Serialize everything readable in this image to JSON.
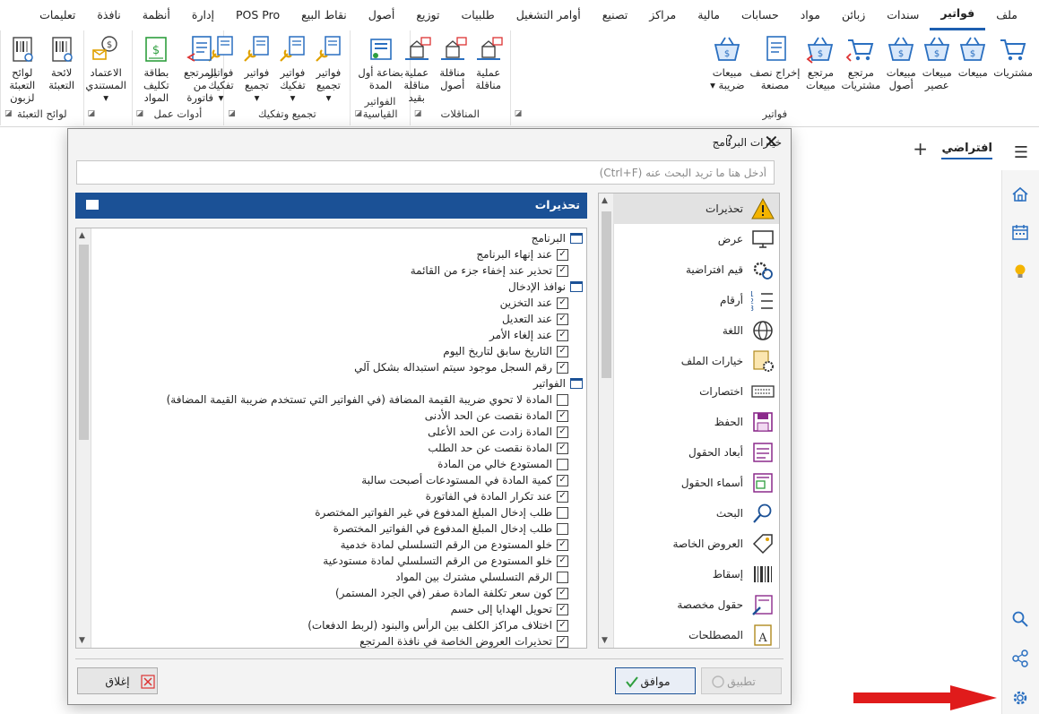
{
  "menubar": {
    "items": [
      "ملف",
      "فواتير",
      "سندات",
      "زبائن",
      "مواد",
      "حسابات",
      "مالية",
      "مراكز",
      "تصنيع",
      "أوامر التشغيل",
      "طلبيات",
      "توزيع",
      "أصول",
      "نقاط البيع",
      "POS Pro",
      "إدارة",
      "أنظمة",
      "نافذة",
      "تعليمات"
    ],
    "active_index": 1
  },
  "ribbon": {
    "groups": [
      {
        "title": "فواتير",
        "buttons": [
          "مشتريات",
          "مبيعات",
          "مبيعات\nعصير",
          "مبيعات\nأصول",
          "مرتجع\nمشتريات",
          "مرتجع\nمبيعات",
          "إخراج نصف\nمصنعة",
          "مبيعات\nضريبة ▾"
        ]
      },
      {
        "title": "المناقلات",
        "buttons": [
          "عملية\nمناقلة",
          "مناقلة\nأصول",
          "عملية\nمناقلة بقيد"
        ]
      },
      {
        "title": "الفواتير القياسية",
        "buttons": [
          "بضاعة أول\nالمدة"
        ]
      },
      {
        "title": "تجميع وتفكيك",
        "buttons": [
          "فواتير\nتجميع ▾",
          "فواتير\nتفكيك ▾",
          "فواتير\nتجميع ▾",
          "فواتير\nتفكيك ▾"
        ]
      },
      {
        "title": "أدوات عمل",
        "buttons": [
          "المرتجع\nمن فاتورة",
          "بطاقة تكليف\nالمواد"
        ]
      },
      {
        "title": "",
        "buttons": [
          "الاعتماد\nالمستندي ▾"
        ]
      },
      {
        "title": "لوائح التعبئة",
        "buttons": [
          "لائحة\nالتعبئة",
          "لوائح التعبئة\nلزبون"
        ]
      }
    ],
    "launcher_glyph": "◪"
  },
  "doc_tabs": {
    "active_label": "افتراضي",
    "plus_label": "+",
    "menu_glyph": "☰"
  },
  "dialog": {
    "title": "خيارات البرنامج",
    "help_glyph": "?",
    "close_glyph": "✕",
    "search_placeholder": "أدخل هنا ما تريد البحث عنه (Ctrl+F)",
    "panel_title": "تحذيرات",
    "categories": [
      "تحذيرات",
      "عرض",
      "قيم افتراضية",
      "أرقام",
      "اللغة",
      "خيارات الملف",
      "اختصارات",
      "الحفظ",
      "أبعاد الحقول",
      "أسماء الحقول",
      "البحث",
      "العروض الخاصة",
      "إسقاط",
      "حقول مخصصة",
      "المصطلحات"
    ],
    "selected_category": 0,
    "rows": [
      {
        "type": "section",
        "label": "البرنامج"
      },
      {
        "type": "option",
        "label": "عند إنهاء البرنامج",
        "checked": true
      },
      {
        "type": "option",
        "label": "تحذير عند إخفاء جزء من القائمة",
        "checked": true
      },
      {
        "type": "section",
        "label": "نوافذ الإدخال"
      },
      {
        "type": "option",
        "label": "عند التخزين",
        "checked": true
      },
      {
        "type": "option",
        "label": "عند التعديل",
        "checked": true
      },
      {
        "type": "option",
        "label": "عند إلغاء الأمر",
        "checked": true
      },
      {
        "type": "option",
        "label": "التاريخ سابق لتاريخ اليوم",
        "checked": true
      },
      {
        "type": "option",
        "label": "رقم السجل موجود سيتم استبداله بشكل آلي",
        "checked": true
      },
      {
        "type": "section",
        "label": "الفواتير"
      },
      {
        "type": "option",
        "label": "المادة لا تحوي ضريبة القيمة المضافة (في الفواتير التي تستخدم ضريبة القيمة المضافة)",
        "checked": false
      },
      {
        "type": "option",
        "label": "المادة نقصت عن الحد الأدنى",
        "checked": true
      },
      {
        "type": "option",
        "label": "المادة زادت عن الحد الأعلى",
        "checked": true
      },
      {
        "type": "option",
        "label": "المادة نقصت عن حد الطلب",
        "checked": true
      },
      {
        "type": "option",
        "label": "المستودع خالي من المادة",
        "checked": false
      },
      {
        "type": "option",
        "label": "كمية المادة في المستودعات أصبحت سالبة",
        "checked": true
      },
      {
        "type": "option",
        "label": "عند تكرار المادة في الفاتورة",
        "checked": true
      },
      {
        "type": "option",
        "label": "طلب إدخال المبلغ المدفوع في غير الفواتير المختصرة",
        "checked": false
      },
      {
        "type": "option",
        "label": "طلب إدخال المبلغ المدفوع في الفواتير المختصرة",
        "checked": false
      },
      {
        "type": "option",
        "label": "خلو المستودع من الرقم التسلسلي لمادة خدمية",
        "checked": true
      },
      {
        "type": "option",
        "label": "خلو المستودع من الرقم التسلسلي لمادة مستودعية",
        "checked": true
      },
      {
        "type": "option",
        "label": "الرقم التسلسلي مشترك بين المواد",
        "checked": false
      },
      {
        "type": "option",
        "label": "كون سعر تكلفة المادة صفر (في الجرد المستمر)",
        "checked": true
      },
      {
        "type": "option",
        "label": "تحويل الهدايا إلى حسم",
        "checked": true
      },
      {
        "type": "option",
        "label": "اختلاف مراكز الكلف بين الرأس والبنود (لربط الدفعات)",
        "checked": true
      },
      {
        "type": "option",
        "label": "تحذيرات العروض الخاصة في نافذة المرتجع",
        "checked": true
      }
    ],
    "buttons": {
      "ok": "موافق",
      "apply": "تطبيق",
      "close": "إغلاق"
    }
  },
  "colors": {
    "accent": "#1b5196",
    "ribbon_icon": "#2a6fc0",
    "arrow": "#e01b1b"
  }
}
